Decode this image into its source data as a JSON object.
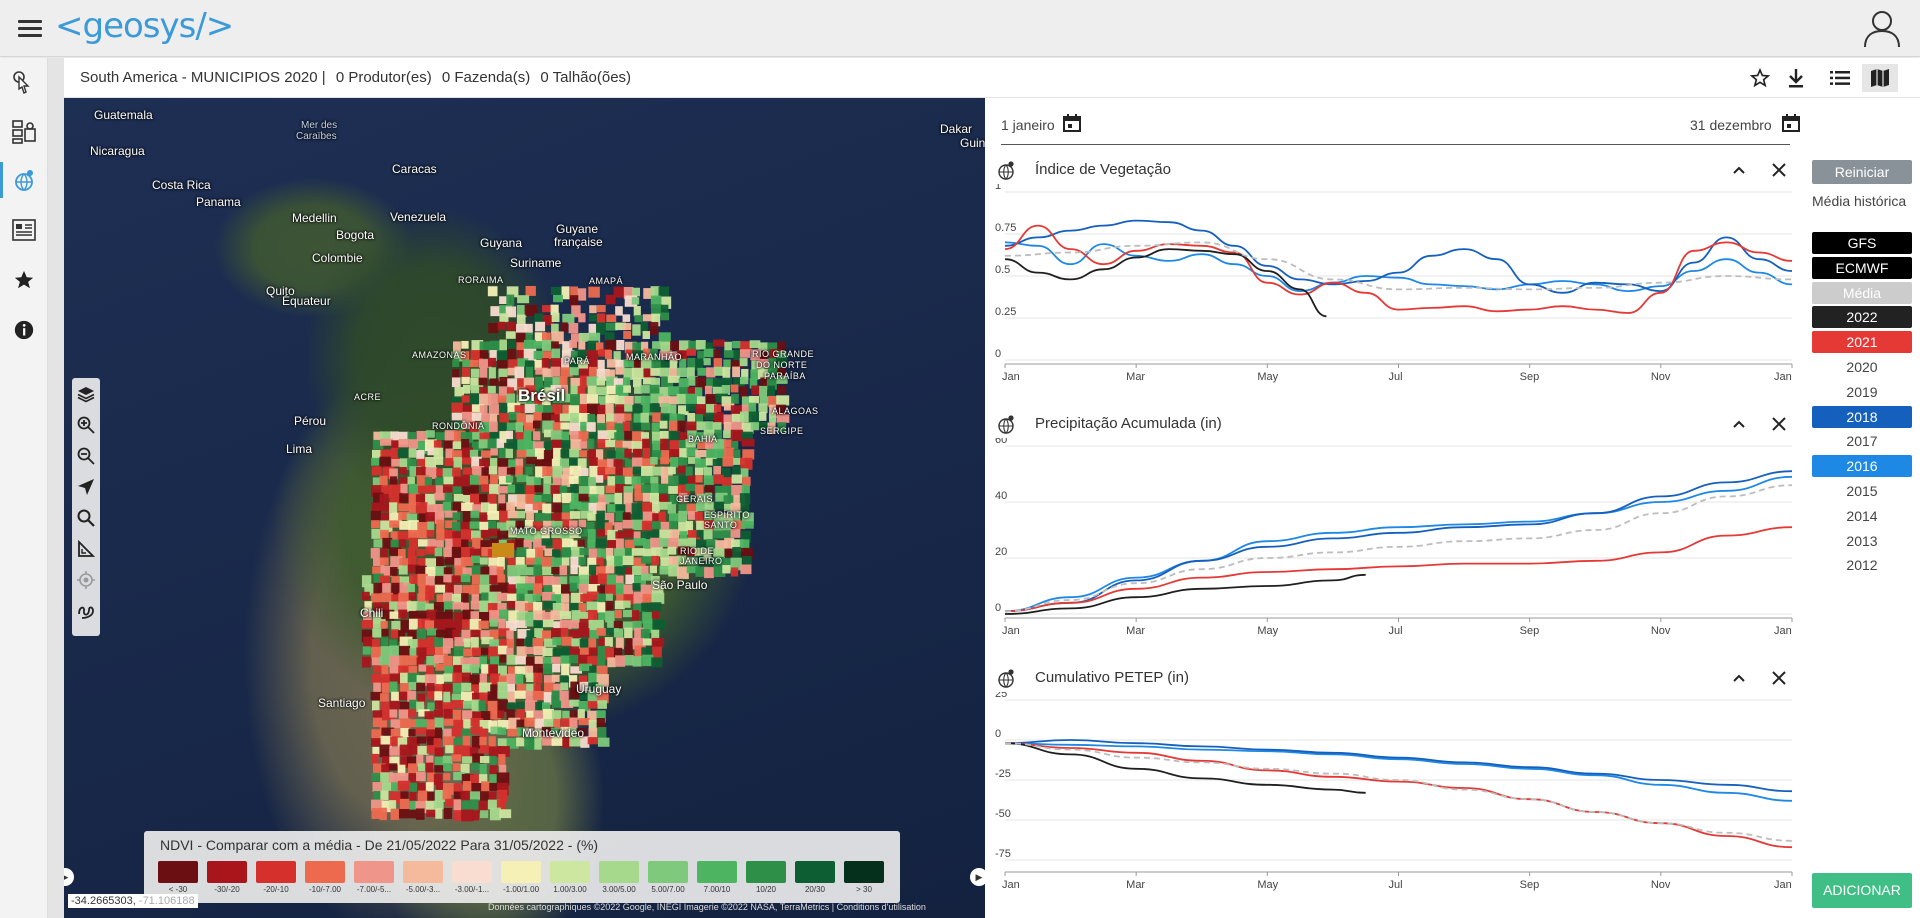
{
  "app": {
    "logo": "<geosys/>"
  },
  "header": {
    "breadcrumb_title": "South America - MUNICIPIOS 2020 |",
    "producers": "0 Produtor(es)",
    "farms": "0 Fazenda(s)",
    "fields": "0 Talhão(ões)"
  },
  "map": {
    "labels": [
      {
        "text": "Guatemala",
        "cls": ""
      },
      {
        "text": "Nicaragua",
        "cls": ""
      },
      {
        "text": "Costa Rica",
        "cls": ""
      },
      {
        "text": "Panama",
        "cls": ""
      },
      {
        "text": "Mer des",
        "cls": "ocean"
      },
      {
        "text": "Caraïbes",
        "cls": "ocean"
      },
      {
        "text": "Caracas",
        "cls": ""
      },
      {
        "text": "Medellin",
        "cls": ""
      },
      {
        "text": "Bogota",
        "cls": ""
      },
      {
        "text": "Venezuela",
        "cls": ""
      },
      {
        "text": "Colombie",
        "cls": ""
      },
      {
        "text": "Guyana",
        "cls": ""
      },
      {
        "text": "Guyane",
        "cls": ""
      },
      {
        "text": "française",
        "cls": ""
      },
      {
        "text": "Suriname",
        "cls": ""
      },
      {
        "text": "RORAIMA",
        "cls": "small"
      },
      {
        "text": "AMAPÁ",
        "cls": "small"
      },
      {
        "text": "Quito",
        "cls": ""
      },
      {
        "text": "Équateur",
        "cls": ""
      },
      {
        "text": "AMAZONAS",
        "cls": "small"
      },
      {
        "text": "PARÁ",
        "cls": "small"
      },
      {
        "text": "MARANHÃO",
        "cls": "small"
      },
      {
        "text": "RIO GRANDE",
        "cls": "small"
      },
      {
        "text": "DO NORTE",
        "cls": "small"
      },
      {
        "text": "PARAÍBA",
        "cls": "small"
      },
      {
        "text": "ACRE",
        "cls": "small"
      },
      {
        "text": "Brésil",
        "cls": "big"
      },
      {
        "text": "ALAGOAS",
        "cls": "small"
      },
      {
        "text": "Pérou",
        "cls": ""
      },
      {
        "text": "RONDÔNIA",
        "cls": "small"
      },
      {
        "text": "SERGIPE",
        "cls": "small"
      },
      {
        "text": "BAHIA",
        "cls": "small"
      },
      {
        "text": "Lima",
        "cls": ""
      },
      {
        "text": "GERAIS",
        "cls": "small"
      },
      {
        "text": "MATO GROSSO",
        "cls": "small"
      },
      {
        "text": "ESPÍRITO",
        "cls": "small"
      },
      {
        "text": "SANTO",
        "cls": "small"
      },
      {
        "text": "RIO DE",
        "cls": "small"
      },
      {
        "text": "JANEIRO",
        "cls": "small"
      },
      {
        "text": "São Paulo",
        "cls": ""
      },
      {
        "text": "Chili",
        "cls": ""
      },
      {
        "text": "Santiago",
        "cls": ""
      },
      {
        "text": "Uruguay",
        "cls": ""
      },
      {
        "text": "Montevideo",
        "cls": ""
      },
      {
        "text": "Dakar",
        "cls": ""
      },
      {
        "text": "Guinée",
        "cls": ""
      }
    ],
    "coords": "-34.2665303,",
    "coords_dim": "-71.106188",
    "attribution": "Données cartographiques ©2022 Google, INEGI Imagerie ©2022 NASA, TerraMetrics | Conditions d'utilisation",
    "legend": {
      "title": "NDVI - Comparar com a média - De 21/05/2022 Para 31/05/2022 - (%)",
      "items": [
        {
          "label": "< -30",
          "color": "#6b0f12"
        },
        {
          "label": "-30/-20",
          "color": "#a8161c"
        },
        {
          "label": "-20/-10",
          "color": "#d6302d"
        },
        {
          "label": "-10/-7.00",
          "color": "#ed6a4f"
        },
        {
          "label": "-7.00/-5...",
          "color": "#f09589"
        },
        {
          "label": "-5.00/-3...",
          "color": "#f5b99c"
        },
        {
          "label": "-3.00/-1...",
          "color": "#f8ddd0"
        },
        {
          "label": "-1.00/1.00",
          "color": "#f4f0b6"
        },
        {
          "label": "1.00/3.00",
          "color": "#cde6a0"
        },
        {
          "label": "3.00/5.00",
          "color": "#a6d98c"
        },
        {
          "label": "5.00/7.00",
          "color": "#7fc97c"
        },
        {
          "label": "7.00/10",
          "color": "#4db461"
        },
        {
          "label": "10/20",
          "color": "#2e8f49"
        },
        {
          "label": "20/30",
          "color": "#0e5e33"
        },
        {
          "label": "> 30",
          "color": "#05301c"
        }
      ]
    }
  },
  "panel": {
    "date_start": "1 janeiro",
    "date_end": "31 dezembro",
    "reset_label": "Reiniciar",
    "historical_label": "Média histórica",
    "add_label": "ADICIONAR",
    "years": [
      {
        "label": "GFS",
        "bg": "#000000",
        "fg": "#ffffff"
      },
      {
        "label": "ECMWF",
        "bg": "#000000",
        "fg": "#ffffff"
      },
      {
        "label": "Média",
        "bg": "#cccccc",
        "fg": "#ffffff"
      },
      {
        "label": "2022",
        "bg": "#222222",
        "fg": "#ffffff"
      },
      {
        "label": "2021",
        "bg": "#e53935",
        "fg": "#ffffff"
      },
      {
        "label": "2020",
        "bg": "",
        "fg": "#444444"
      },
      {
        "label": "2019",
        "bg": "",
        "fg": "#444444"
      },
      {
        "label": "2018",
        "bg": "#1560bd",
        "fg": "#ffffff"
      },
      {
        "label": "2017",
        "bg": "",
        "fg": "#444444"
      },
      {
        "label": "2016",
        "bg": "#1e88e5",
        "fg": "#ffffff"
      },
      {
        "label": "2015",
        "bg": "",
        "fg": "#444444"
      },
      {
        "label": "2014",
        "bg": "",
        "fg": "#444444"
      },
      {
        "label": "2013",
        "bg": "",
        "fg": "#444444"
      },
      {
        "label": "2012",
        "bg": "",
        "fg": "#444444"
      }
    ]
  },
  "colors": {
    "y2022": "#1f1f1f",
    "y2021": "#e53935",
    "y2018": "#1560bd",
    "y2016": "#1e88e5",
    "media": "#bdbdbd",
    "accent": "#3b9ad8",
    "add": "#3fbf85"
  },
  "chart_data": [
    {
      "type": "line",
      "title": "Índice de Vegetação",
      "x": [
        "Jan",
        "Mar",
        "May",
        "Jul",
        "Sep",
        "Nov",
        "Jan"
      ],
      "yticks": [
        "1",
        "0.75",
        "0.5",
        "0.25",
        "0"
      ],
      "ylim": [
        0,
        1
      ],
      "series": [
        {
          "name": "2016",
          "color": "#1e88e5",
          "dash": false,
          "x": [
            0,
            0.5,
            1,
            1.5,
            2,
            2.5,
            3,
            3.5,
            4,
            4.5,
            5,
            5.5,
            6,
            6.5,
            7,
            7.5,
            8,
            8.5,
            9,
            9.5,
            10,
            10.5,
            11,
            11.5,
            12
          ],
          "y": [
            0.7,
            0.68,
            0.57,
            0.69,
            0.62,
            0.59,
            0.63,
            0.57,
            0.5,
            0.41,
            0.46,
            0.5,
            0.49,
            0.45,
            0.44,
            0.42,
            0.45,
            0.47,
            0.45,
            0.41,
            0.44,
            0.53,
            0.6,
            0.52,
            0.45
          ]
        },
        {
          "name": "2018",
          "color": "#1560bd",
          "dash": false,
          "x": [
            0,
            0.5,
            1,
            1.5,
            2,
            2.5,
            3,
            3.5,
            4,
            4.5,
            5,
            5.5,
            6,
            6.5,
            7,
            7.5,
            8,
            8.5,
            9,
            9.5,
            10,
            10.5,
            11,
            11.5,
            12
          ],
          "y": [
            0.68,
            0.73,
            0.77,
            0.8,
            0.83,
            0.82,
            0.77,
            0.68,
            0.56,
            0.48,
            0.45,
            0.47,
            0.52,
            0.62,
            0.66,
            0.6,
            0.45,
            0.4,
            0.46,
            0.45,
            0.41,
            0.58,
            0.73,
            0.6,
            0.53
          ]
        },
        {
          "name": "2021",
          "color": "#e53935",
          "dash": false,
          "x": [
            0,
            0.5,
            1,
            1.5,
            2,
            2.5,
            3,
            3.5,
            4,
            4.5,
            5,
            5.5,
            6,
            6.5,
            7,
            7.5,
            8,
            8.5,
            9,
            9.5,
            10,
            10.5,
            11,
            11.5,
            12
          ],
          "y": [
            0.66,
            0.8,
            0.66,
            0.57,
            0.65,
            0.69,
            0.68,
            0.64,
            0.46,
            0.39,
            0.46,
            0.4,
            0.3,
            0.31,
            0.32,
            0.29,
            0.3,
            0.32,
            0.3,
            0.28,
            0.4,
            0.65,
            0.7,
            0.64,
            0.59
          ]
        },
        {
          "name": "2022",
          "color": "#1f1f1f",
          "dash": false,
          "x": [
            0,
            0.5,
            1,
            1.5,
            2,
            2.5,
            3,
            3.5,
            4,
            4.5,
            4.9
          ],
          "y": [
            0.6,
            0.52,
            0.48,
            0.54,
            0.61,
            0.66,
            0.65,
            0.63,
            0.53,
            0.42,
            0.26
          ]
        },
        {
          "name": "Média",
          "color": "#bdbdbd",
          "dash": true,
          "x": [
            0,
            1,
            2,
            3,
            4,
            5,
            6,
            7,
            8,
            9,
            10,
            11,
            12
          ],
          "y": [
            0.62,
            0.64,
            0.68,
            0.7,
            0.6,
            0.48,
            0.42,
            0.43,
            0.42,
            0.43,
            0.46,
            0.5,
            0.48
          ]
        }
      ]
    },
    {
      "type": "line",
      "title": "Precipitação Acumulada (in)",
      "x": [
        "Jan",
        "Mar",
        "May",
        "Jul",
        "Sep",
        "Nov",
        "Jan"
      ],
      "yticks": [
        "60",
        "40",
        "20",
        "0"
      ],
      "ylim": [
        0,
        60
      ],
      "series": [
        {
          "name": "2016",
          "color": "#1e88e5",
          "dash": false,
          "x": [
            0,
            1,
            2,
            3,
            4,
            5,
            6,
            7,
            8,
            9,
            10,
            11,
            12
          ],
          "y": [
            1,
            6,
            13,
            19,
            26,
            29,
            31,
            32,
            33,
            36,
            40,
            44,
            49
          ]
        },
        {
          "name": "2018",
          "color": "#1560bd",
          "dash": false,
          "x": [
            0,
            1,
            2,
            3,
            4,
            5,
            6,
            7,
            8,
            9,
            10,
            11,
            12
          ],
          "y": [
            1,
            4,
            12,
            19,
            24,
            27,
            29,
            31,
            32,
            36,
            42,
            47,
            51
          ]
        },
        {
          "name": "2021",
          "color": "#e53935",
          "dash": false,
          "x": [
            0,
            1,
            2,
            3,
            4,
            5,
            6,
            7,
            8,
            9,
            10,
            11,
            12
          ],
          "y": [
            1,
            4,
            9,
            13,
            15,
            16,
            17,
            18,
            18,
            19,
            22,
            28,
            31
          ]
        },
        {
          "name": "2022",
          "color": "#1f1f1f",
          "dash": false,
          "x": [
            0,
            1,
            2,
            3,
            4,
            5,
            5.5
          ],
          "y": [
            0,
            2,
            6,
            9,
            10,
            12,
            14
          ]
        },
        {
          "name": "Média",
          "color": "#bdbdbd",
          "dash": true,
          "x": [
            0,
            1,
            2,
            3,
            4,
            5,
            6,
            7,
            8,
            9,
            10,
            11,
            12
          ],
          "y": [
            1,
            5,
            11,
            16,
            20,
            22,
            24,
            26,
            27,
            30,
            36,
            42,
            46
          ]
        }
      ]
    },
    {
      "type": "line",
      "title": "Cumulativo PETEP (in)",
      "x": [
        "Jan",
        "Mar",
        "May",
        "Jul",
        "Sep",
        "Nov",
        "Jan"
      ],
      "yticks": [
        "25",
        "0",
        "-25",
        "-50",
        "-75"
      ],
      "ylim": [
        -80,
        25
      ],
      "series": [
        {
          "name": "2016",
          "color": "#1e88e5",
          "dash": false,
          "x": [
            0,
            1,
            2,
            3,
            4,
            5,
            6,
            7,
            8,
            9,
            10,
            11,
            12
          ],
          "y": [
            -2,
            -3,
            -4,
            -6,
            -7,
            -9,
            -12,
            -15,
            -18,
            -22,
            -28,
            -33,
            -38
          ]
        },
        {
          "name": "2018",
          "color": "#1560bd",
          "dash": false,
          "x": [
            0,
            1,
            2,
            3,
            4,
            5,
            6,
            7,
            8,
            9,
            10,
            11,
            12
          ],
          "y": [
            -2,
            0,
            -2,
            -4,
            -6,
            -8,
            -11,
            -14,
            -17,
            -21,
            -25,
            -28,
            -32
          ]
        },
        {
          "name": "2021",
          "color": "#e53935",
          "dash": false,
          "x": [
            0,
            1,
            2,
            3,
            4,
            5,
            6,
            7,
            8,
            9,
            10,
            11,
            12
          ],
          "y": [
            -2,
            -5,
            -8,
            -13,
            -19,
            -23,
            -26,
            -30,
            -37,
            -45,
            -52,
            -60,
            -67
          ]
        },
        {
          "name": "2022",
          "color": "#1f1f1f",
          "dash": false,
          "x": [
            0,
            1,
            2,
            3,
            4,
            5,
            5.5
          ],
          "y": [
            -2,
            -9,
            -18,
            -24,
            -28,
            -31,
            -33
          ]
        },
        {
          "name": "Média",
          "color": "#bdbdbd",
          "dash": true,
          "x": [
            0,
            1,
            2,
            3,
            4,
            5,
            6,
            7,
            8,
            9,
            10,
            11,
            12
          ],
          "y": [
            -2,
            -6,
            -11,
            -14,
            -18,
            -21,
            -25,
            -31,
            -37,
            -45,
            -52,
            -58,
            -63
          ]
        }
      ]
    }
  ]
}
